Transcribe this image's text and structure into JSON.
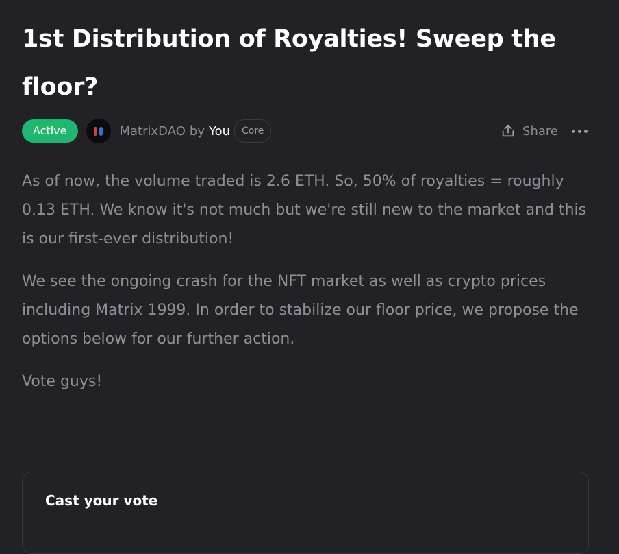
{
  "proposal": {
    "title": "1st Distribution of Royalties! Sweep the floor?",
    "status": "Active",
    "space_name": "MatrixDAO",
    "by_label": "by",
    "author": "You",
    "author_role": "Core",
    "share_label": "Share",
    "body": [
      "As of now, the volume traded is 2.6 ETH. So, 50% of royalties = roughly 0.13 ETH. We know it's not much but we're still new to the market and this is our first-ever distribution!",
      "We see the ongoing crash for the NFT market as well as crypto prices including Matrix 1999. In order to stabilize our floor price, we propose the options below for our further action.",
      "Vote guys!"
    ]
  },
  "vote": {
    "title": "Cast your vote"
  },
  "icons": {
    "share": "share-icon",
    "more": "more-options-icon",
    "avatar": "matrix-pills-avatar"
  },
  "colors": {
    "background": "#222126",
    "status_active": "#21b66f",
    "text_primary": "#ffffff",
    "text_muted": "#8e8e97",
    "border": "#38373d"
  }
}
